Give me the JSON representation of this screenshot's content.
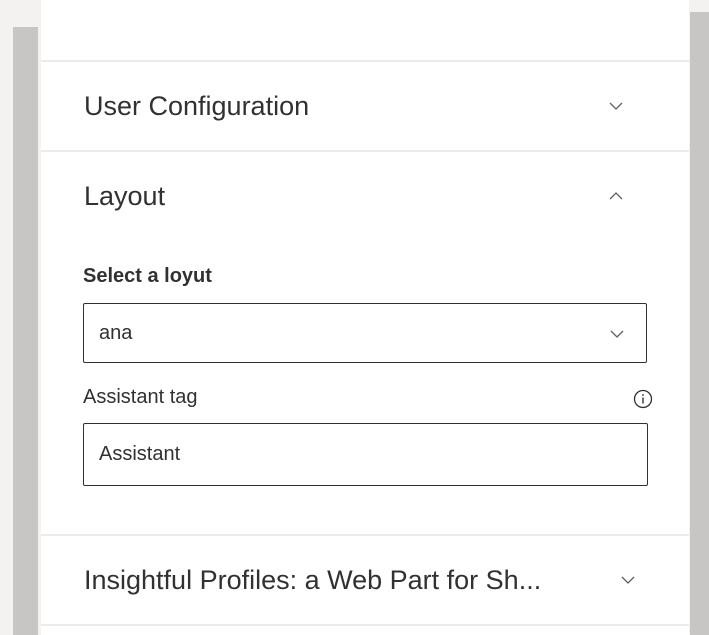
{
  "panel": {
    "groups": [
      {
        "title": "User Configuration",
        "expanded": false,
        "chevron_icon": "chevron-down-icon"
      },
      {
        "title": "Layout",
        "expanded": true,
        "chevron_icon": "chevron-up-icon"
      },
      {
        "title": "Insightful Profiles: a Web Part for Sh...",
        "expanded": false,
        "chevron_icon": "chevron-down-icon"
      }
    ]
  },
  "layout_group": {
    "select_label": "Select a loyut",
    "select_value": "ana",
    "select_icon": "chevron-down-icon",
    "assistant_tag_label": "Assistant tag",
    "assistant_tag_info_icon": "info-icon",
    "assistant_tag_value": "Assistant"
  },
  "colors": {
    "text": "#323130",
    "divider": "#edebe9",
    "scrollbar": "#c8c6c4",
    "chevron": "#605e5c"
  }
}
